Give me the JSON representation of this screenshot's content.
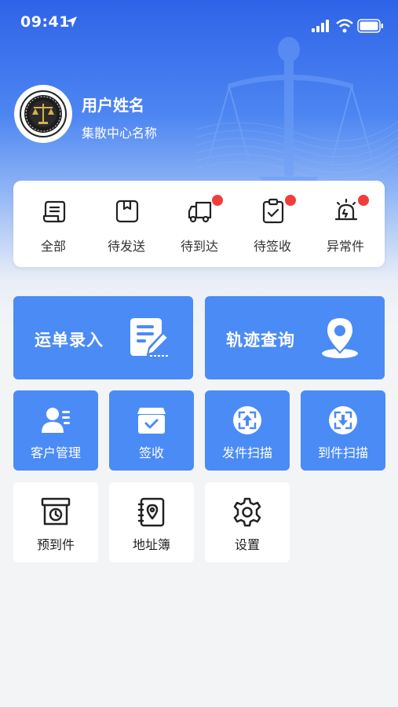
{
  "status_bar": {
    "time": "09:41"
  },
  "profile": {
    "name": "用户姓名",
    "center": "集散中心名称"
  },
  "status_tabs": [
    {
      "label": "全部",
      "icon": "scroll-icon",
      "badge": false
    },
    {
      "label": "待发送",
      "icon": "box-icon",
      "badge": false
    },
    {
      "label": "待到达",
      "icon": "truck-icon",
      "badge": true
    },
    {
      "label": "待签收",
      "icon": "clipboard-check-icon",
      "badge": true
    },
    {
      "label": "异常件",
      "icon": "alarm-icon",
      "badge": true
    }
  ],
  "big_actions": [
    {
      "label": "运单录入",
      "icon": "edit-document-icon"
    },
    {
      "label": "轨迹查询",
      "icon": "location-pin-icon"
    }
  ],
  "tiles_row1": [
    {
      "label": "客户管理",
      "icon": "customer-icon"
    },
    {
      "label": "签收",
      "icon": "package-check-icon"
    },
    {
      "label": "发件扫描",
      "icon": "scan-up-icon"
    },
    {
      "label": "到件扫描",
      "icon": "scan-down-icon"
    }
  ],
  "tiles_row2": [
    {
      "label": "预到件",
      "icon": "pre-arrival-icon"
    },
    {
      "label": "地址簿",
      "icon": "address-book-icon"
    },
    {
      "label": "设置",
      "icon": "gear-icon"
    }
  ],
  "colors": {
    "primary": "#4b8bf5",
    "badge": "#f43b3b",
    "background": "#f3f4f6"
  }
}
